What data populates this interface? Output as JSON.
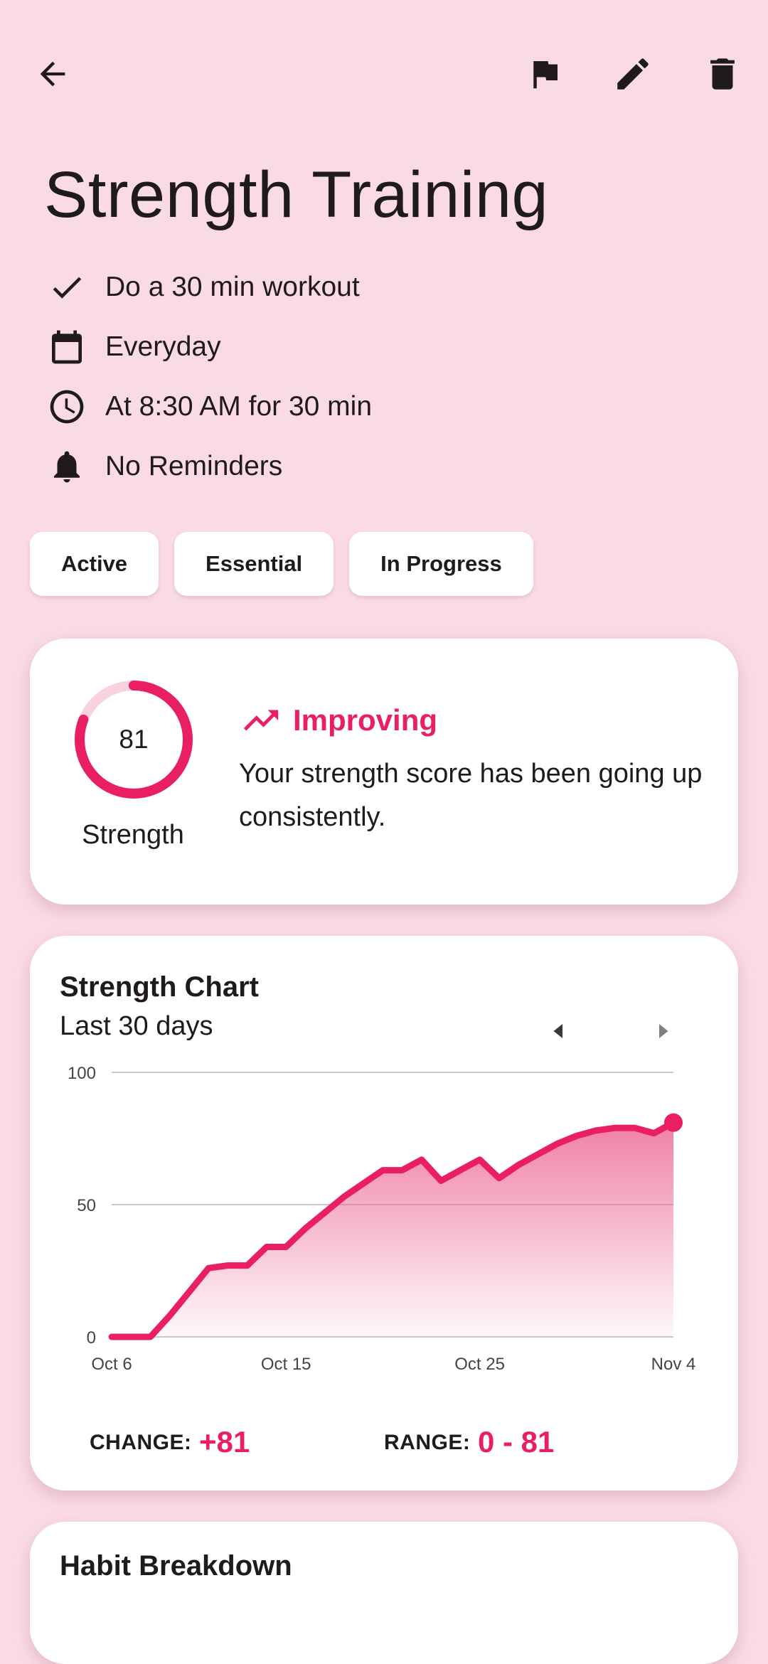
{
  "header": {
    "back_icon": "arrow-back-icon",
    "actions": [
      "flag-icon",
      "edit-icon",
      "delete-icon"
    ]
  },
  "habit": {
    "title": "Strength Training",
    "details": [
      {
        "icon": "check-icon",
        "text": "Do a 30 min workout"
      },
      {
        "icon": "calendar-icon",
        "text": "Everyday"
      },
      {
        "icon": "clock-icon",
        "text": "At 8:30 AM for 30 min"
      },
      {
        "icon": "bell-icon",
        "text": "No Reminders"
      }
    ],
    "chips": [
      "Active",
      "Essential",
      "In Progress"
    ]
  },
  "score": {
    "value": "81",
    "progress": 0.81,
    "label": "Strength",
    "trend_title": "Improving",
    "trend_desc": "Your strength score has been going up consistently."
  },
  "chart": {
    "title": "Strength Chart",
    "subtitle": "Last 30 days",
    "change_label": "CHANGE:",
    "change_value": "+81",
    "range_label": "RANGE:",
    "range_value": "0 - 81"
  },
  "breakdown": {
    "title": "Habit Breakdown"
  },
  "colors": {
    "accent": "#e91e63",
    "background": "#fadbe5",
    "card": "#ffffff"
  },
  "chart_data": {
    "type": "area",
    "x": [
      "Oct 6",
      "Oct 7",
      "Oct 8",
      "Oct 9",
      "Oct 10",
      "Oct 11",
      "Oct 12",
      "Oct 13",
      "Oct 14",
      "Oct 15",
      "Oct 16",
      "Oct 17",
      "Oct 18",
      "Oct 19",
      "Oct 20",
      "Oct 21",
      "Oct 22",
      "Oct 23",
      "Oct 24",
      "Oct 25",
      "Oct 26",
      "Oct 27",
      "Oct 28",
      "Oct 29",
      "Oct 30",
      "Oct 31",
      "Nov 1",
      "Nov 2",
      "Nov 3",
      "Nov 4"
    ],
    "values": [
      0,
      0,
      0,
      8,
      17,
      26,
      27,
      27,
      34,
      34,
      41,
      47,
      53,
      58,
      63,
      63,
      67,
      59,
      63,
      67,
      60,
      65,
      69,
      73,
      76,
      78,
      79,
      79,
      77,
      81
    ],
    "xticks": [
      "Oct 6",
      "Oct 15",
      "Oct 25",
      "Nov 4"
    ],
    "yticks": [
      0,
      50,
      100
    ],
    "ylim": [
      0,
      100
    ],
    "grid": true
  }
}
